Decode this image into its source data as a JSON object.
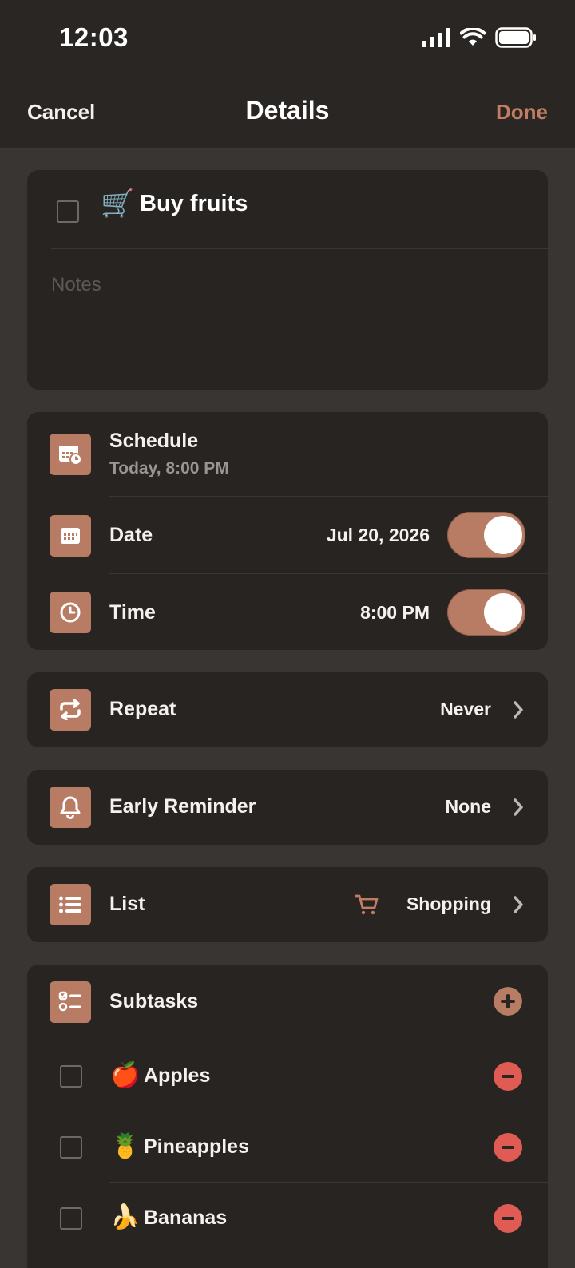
{
  "status_bar": {
    "time": "12:03"
  },
  "nav": {
    "cancel": "Cancel",
    "title": "Details",
    "done": "Done"
  },
  "task": {
    "emoji": "🛒",
    "title": "Buy fruits",
    "notes_placeholder": "Notes"
  },
  "schedule": {
    "label": "Schedule",
    "summary": "Today, 8:00 PM",
    "date_label": "Date",
    "date_value": "Jul 20, 2026",
    "date_enabled": true,
    "time_label": "Time",
    "time_value": "8:00 PM",
    "time_enabled": true
  },
  "repeat": {
    "label": "Repeat",
    "value": "Never"
  },
  "early_reminder": {
    "label": "Early Reminder",
    "value": "None"
  },
  "list": {
    "label": "List",
    "value": "Shopping",
    "icon": "cart-icon"
  },
  "subtasks": {
    "label": "Subtasks",
    "items": [
      {
        "emoji": "🍎",
        "label": "Apples"
      },
      {
        "emoji": "🍍",
        "label": "Pineapples"
      },
      {
        "emoji": "🍌",
        "label": "Bananas"
      }
    ]
  },
  "colors": {
    "accent": "#b87b64",
    "background": "#383532",
    "card": "#282421",
    "remove": "#e05b53"
  }
}
